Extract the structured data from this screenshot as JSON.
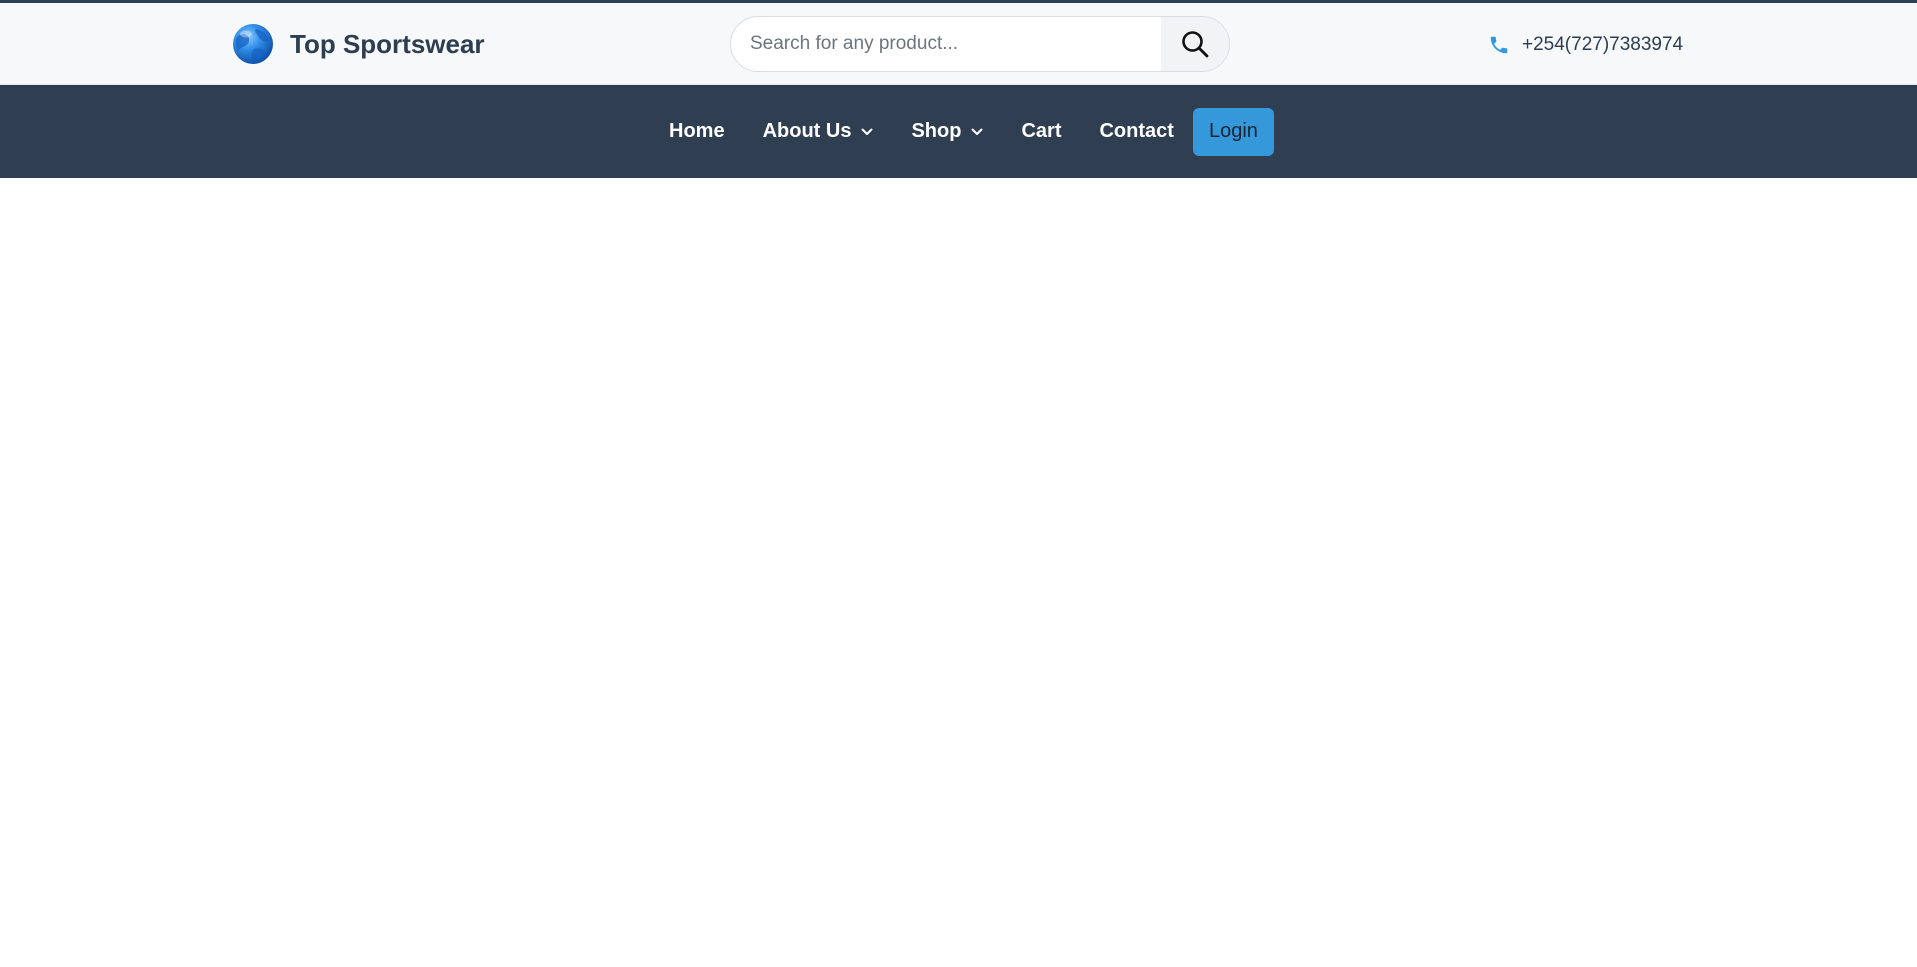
{
  "header": {
    "brand_name": "Top Sportswear",
    "logo_icon": "globe-icon",
    "phone": "+254(727)7383974",
    "phone_icon": "phone-icon"
  },
  "search": {
    "placeholder": "Search for any product...",
    "value": "",
    "button_icon": "search-icon"
  },
  "nav": {
    "items": [
      {
        "label": "Home",
        "has_dropdown": false
      },
      {
        "label": "About Us",
        "has_dropdown": true
      },
      {
        "label": "Shop",
        "has_dropdown": true
      },
      {
        "label": "Cart",
        "has_dropdown": false
      },
      {
        "label": "Contact",
        "has_dropdown": false
      }
    ],
    "login_label": "Login"
  },
  "colors": {
    "navbar_bg": "#2f3e50",
    "accent": "#3498db",
    "brand_text": "#2c3e50",
    "topbar_bg": "#f7f8fa"
  }
}
